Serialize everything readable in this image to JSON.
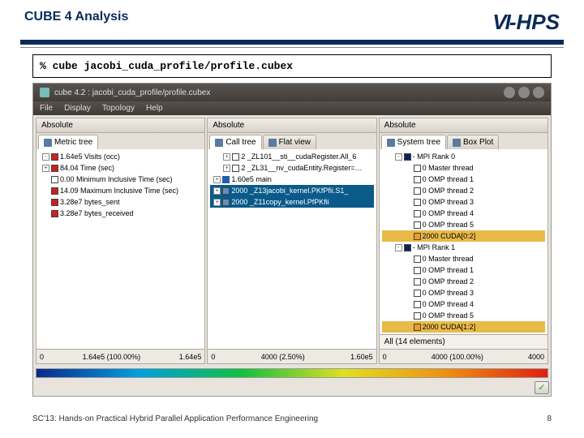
{
  "slide": {
    "title": "CUBE 4 Analysis",
    "logo": "VI-HPS",
    "footer": "SC'13: Hands-on Practical Hybrid Parallel Application Performance Engineering",
    "page": "8"
  },
  "command": "% cube jacobi_cuda_profile/profile.cubex",
  "window": {
    "title": "cube 4.2 : jacobi_cuda_profile/profile.cubex",
    "menu": [
      "File",
      "Display",
      "Topology",
      "Help"
    ]
  },
  "panes": [
    {
      "header": "Absolute",
      "tabs": [
        {
          "icon": true,
          "label": "Metric tree",
          "active": true
        }
      ],
      "tree": [
        {
          "indent": 0,
          "exp": "-",
          "color": "red",
          "text": "1.64e5 Visits (occ)"
        },
        {
          "indent": 0,
          "exp": "+",
          "color": "red",
          "text": "84.04 Time (sec)"
        },
        {
          "indent": 0,
          "exp": "",
          "color": "white",
          "text": "0.00 Minimum Inclusive Time (sec)"
        },
        {
          "indent": 0,
          "exp": "",
          "color": "red",
          "text": "14.09 Maximum Inclusive Time (sec)"
        },
        {
          "indent": 0,
          "exp": "",
          "color": "red",
          "text": "3.28e7 bytes_sent"
        },
        {
          "indent": 0,
          "exp": "",
          "color": "red",
          "text": "3.28e7 bytes_received"
        }
      ],
      "axis": {
        "left": "0",
        "mid": "1.64e5 (100.00%)",
        "right": "1.64e5"
      }
    },
    {
      "header": "Absolute",
      "tabs": [
        {
          "icon": true,
          "label": "Call tree",
          "active": true
        },
        {
          "icon": true,
          "label": "Flat view",
          "active": false
        }
      ],
      "tree": [
        {
          "indent": 1,
          "exp": "+",
          "color": "white",
          "text": "2 _ZL101__sti__cudaRegister.All_6"
        },
        {
          "indent": 1,
          "exp": "+",
          "color": "white",
          "text": "2 _ZL31__nv_cudaEntity.Register=…"
        },
        {
          "indent": 0,
          "exp": "+",
          "color": "blue",
          "text": "1.60e5 main"
        },
        {
          "indent": 0,
          "exp": "+",
          "color": "lblue",
          "text": "2000 _Z13jacobi_kernel.PKfPfii.S1_",
          "sel": true
        },
        {
          "indent": 0,
          "exp": "+",
          "color": "lblue",
          "text": "2000 _Z11copy_kernel.PfPKfii",
          "sel": true
        }
      ],
      "axis": {
        "left": "0",
        "mid": "4000 (2.50%)",
        "right": "1.60e5"
      }
    },
    {
      "header": "Absolute",
      "tabs": [
        {
          "icon": true,
          "label": "System tree",
          "active": true
        },
        {
          "icon": true,
          "label": "Box Plot",
          "active": false
        }
      ],
      "tree": [
        {
          "indent": 1,
          "exp": "-",
          "color": "dblue",
          "text": "- MPI Rank 0"
        },
        {
          "indent": 2,
          "exp": "",
          "color": "white",
          "text": "0 Master thread"
        },
        {
          "indent": 2,
          "exp": "",
          "color": "white",
          "text": "0 OMP thread 1"
        },
        {
          "indent": 2,
          "exp": "",
          "color": "white",
          "text": "0 OMP thread 2"
        },
        {
          "indent": 2,
          "exp": "",
          "color": "white",
          "text": "0 OMP thread 3"
        },
        {
          "indent": 2,
          "exp": "",
          "color": "white",
          "text": "0 OMP thread 4"
        },
        {
          "indent": 2,
          "exp": "",
          "color": "white",
          "text": "0 OMP thread 5"
        },
        {
          "indent": 2,
          "exp": "",
          "color": "orange",
          "text": "2000 CUDA[0:2]",
          "sel2": true
        },
        {
          "indent": 1,
          "exp": "-",
          "color": "dblue",
          "text": "- MPI Rank 1"
        },
        {
          "indent": 2,
          "exp": "",
          "color": "white",
          "text": "0 Master thread"
        },
        {
          "indent": 2,
          "exp": "",
          "color": "white",
          "text": "0 OMP thread 1"
        },
        {
          "indent": 2,
          "exp": "",
          "color": "white",
          "text": "0 OMP thread 2"
        },
        {
          "indent": 2,
          "exp": "",
          "color": "white",
          "text": "0 OMP thread 3"
        },
        {
          "indent": 2,
          "exp": "",
          "color": "white",
          "text": "0 OMP thread 4"
        },
        {
          "indent": 2,
          "exp": "",
          "color": "white",
          "text": "0 OMP thread 5"
        },
        {
          "indent": 2,
          "exp": "",
          "color": "orange",
          "text": "2000 CUDA[1:2]",
          "sel2": true
        }
      ],
      "alltext": "All (14 elements)",
      "axis": {
        "left": "0",
        "mid": "4000 (100.00%)",
        "right": "4000"
      }
    }
  ]
}
